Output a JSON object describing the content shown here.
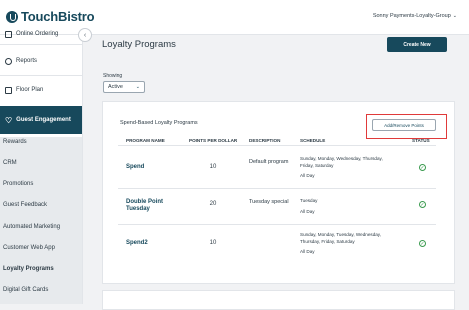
{
  "brand": {
    "name": "TouchBistro",
    "color": "#17495c"
  },
  "account": {
    "name": "Sonny Payments-Loyalty-Group"
  },
  "sidebar": {
    "items": [
      {
        "label": "Online Ordering",
        "icon": "bag-icon"
      },
      {
        "label": "Reports",
        "icon": "chart-icon"
      },
      {
        "label": "Floor Plan",
        "icon": "floor-plan-icon"
      },
      {
        "label": "Guest Engagement",
        "icon": "heart-icon"
      }
    ],
    "submenu": [
      {
        "label": "Rewards"
      },
      {
        "label": "CRM"
      },
      {
        "label": "Promotions"
      },
      {
        "label": "Guest Feedback"
      },
      {
        "label": "Automated Marketing"
      },
      {
        "label": "Customer Web App"
      },
      {
        "label": "Loyalty Programs"
      },
      {
        "label": "Digital Gift Cards"
      }
    ]
  },
  "page": {
    "title": "Loyalty Programs",
    "create_label": "Create New",
    "showing_label": "Showing",
    "filter_value": "Active"
  },
  "card": {
    "title": "Spend-Based Loyalty Programs",
    "add_remove_label": "Add/Remove Points",
    "headers": [
      "PROGRAM NAME",
      "POINTS PER DOLLAR",
      "DESCRIPTION",
      "SCHEDULE",
      "STATUS"
    ],
    "rows": [
      {
        "name": "Spend",
        "points": "10",
        "description": "Default program",
        "schedule_days": "Sunday, Monday, Wednesday, Thursday, Friday, Saturday",
        "schedule_time": "All Day",
        "status": "active"
      },
      {
        "name": "Double Point Tuesday",
        "points": "20",
        "description": "Tuesday special",
        "schedule_days": "Tuesday",
        "schedule_time": "All Day",
        "status": "active"
      },
      {
        "name": "Spend2",
        "points": "10",
        "description": "",
        "schedule_days": "Sunday, Monday, Tuesday, Wednesday, Thursday, Friday, Saturday",
        "schedule_time": "All Day",
        "status": "active"
      }
    ]
  },
  "colors": {
    "primary": "#17495c",
    "highlight": "#e03a3a",
    "status_active": "#3a9a4e"
  }
}
